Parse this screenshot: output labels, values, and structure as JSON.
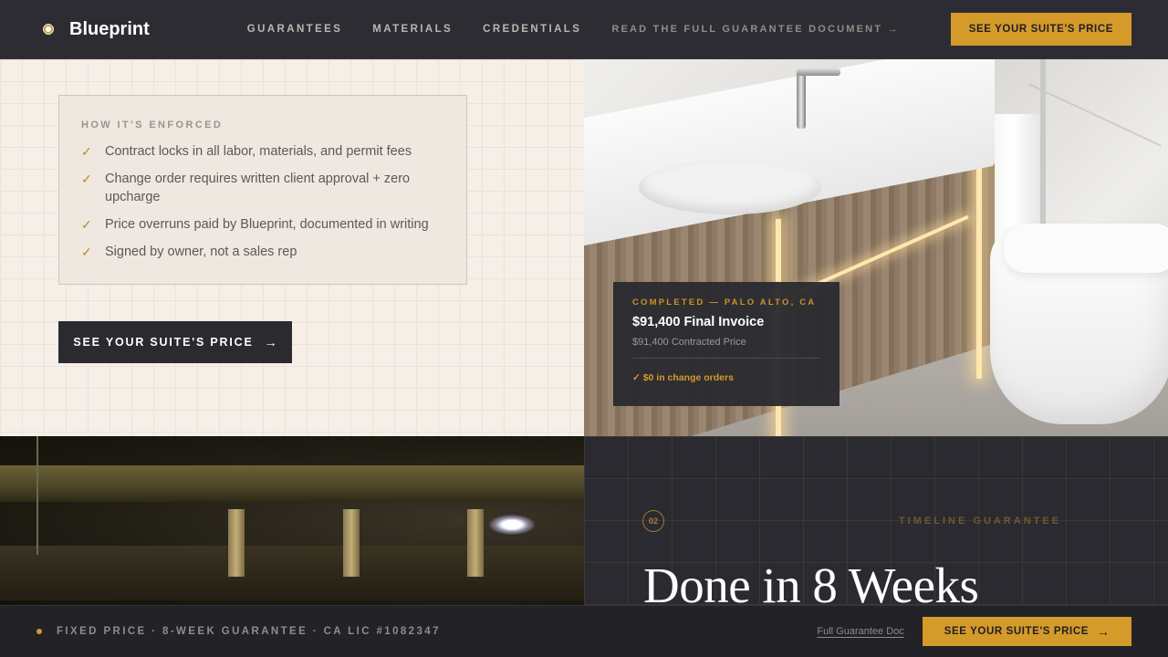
{
  "brand": {
    "name": "Blueprint",
    "icon": "gear-icon"
  },
  "nav": {
    "items": [
      "GUARANTEES",
      "MATERIALS",
      "CREDENTIALS"
    ],
    "doc_link": "READ THE FULL GUARANTEE DOCUMENT →"
  },
  "header": {
    "cta_label": "SEE YOUR SUITE'S PRICE"
  },
  "enforcement": {
    "label": "HOW IT'S ENFORCED",
    "items": [
      "Contract locks in all labor, materials, and permit fees",
      "Change order requires written client approval + zero upcharge",
      "Price overruns paid by Blueprint, documented in writing",
      "Signed by owner, not a sales rep"
    ],
    "check_glyph": "✓"
  },
  "main_cta": {
    "label": "SEE YOUR SUITE'S PRICE",
    "arrow": "→"
  },
  "invoice_card": {
    "eyebrow": "COMPLETED — PALO ALTO, CA",
    "title": "$91,400 Final Invoice",
    "subtitle": "$91,400 Contracted Price",
    "note": "✓ $0 in change orders"
  },
  "timeline": {
    "step_number": "02",
    "label": "TIMELINE GUARANTEE",
    "heading": "Done in 8 Weeks"
  },
  "bottom_bar": {
    "status_text": "FIXED PRICE · 8-WEEK GUARANTEE · CA LIC #1082347",
    "doc_link": "Full Guarantee Doc",
    "cta_label": "SEE YOUR SUITE'S PRICE",
    "cta_arrow": "→"
  },
  "colors": {
    "accent": "#d49a2a",
    "dark": "#2a2a30",
    "cream": "#f5efe8"
  }
}
